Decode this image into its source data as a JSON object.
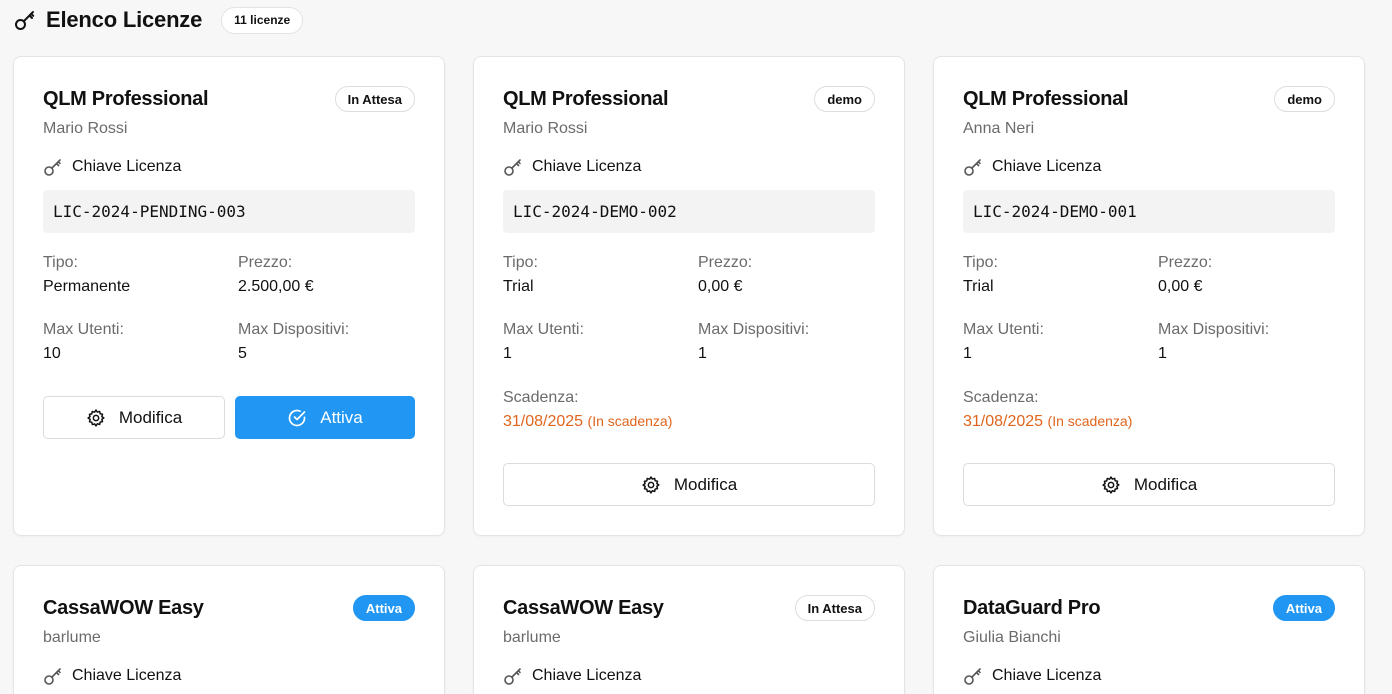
{
  "header": {
    "title": "Elenco Licenze",
    "count": "11 licenze"
  },
  "labels": {
    "key": "Chiave Licenza",
    "type": "Tipo:",
    "price": "Prezzo:",
    "max_users": "Max Utenti:",
    "max_devices": "Max Dispositivi:",
    "expiry": "Scadenza:",
    "edit": "Modifica",
    "activate": "Attiva"
  },
  "colors": {
    "accent": "#2196f3",
    "warning": "#e0651c"
  },
  "cards": [
    {
      "product": "QLM Professional",
      "status": "In Attesa",
      "client": "Mario Rossi",
      "key": "LIC-2024-PENDING-003",
      "type": "Permanente",
      "price": "2.500,00 €",
      "max_users": "10",
      "max_devices": "5"
    },
    {
      "product": "QLM Professional",
      "status": "demo",
      "client": "Mario Rossi",
      "key": "LIC-2024-DEMO-002",
      "type": "Trial",
      "price": "0,00 €",
      "max_users": "1",
      "max_devices": "1",
      "expiry": "31/08/2025",
      "expiry_note": "(In scadenza)"
    },
    {
      "product": "QLM Professional",
      "status": "demo",
      "client": "Anna Neri",
      "key": "LIC-2024-DEMO-001",
      "type": "Trial",
      "price": "0,00 €",
      "max_users": "1",
      "max_devices": "1",
      "expiry": "31/08/2025",
      "expiry_note": "(In scadenza)"
    },
    {
      "product": "CassaWOW Easy",
      "status": "Attiva",
      "client": "barlume"
    },
    {
      "product": "CassaWOW Easy",
      "status": "In Attesa",
      "client": "barlume"
    },
    {
      "product": "DataGuard Pro",
      "status": "Attiva",
      "client": "Giulia Bianchi"
    }
  ]
}
